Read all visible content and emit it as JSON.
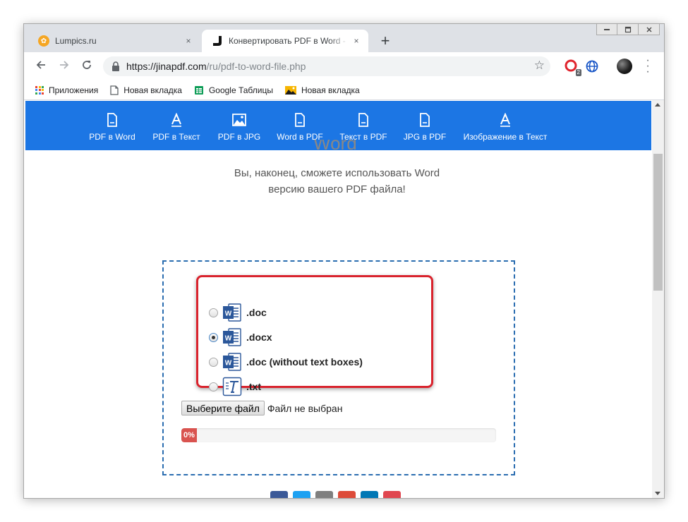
{
  "browser": {
    "tabs": [
      {
        "title": "Lumpics.ru",
        "active": false,
        "favicon": "orange-circle-icon"
      },
      {
        "title": "Конвертировать PDF в Word - PDF",
        "active": true,
        "favicon": "jinapdf-j-icon"
      }
    ],
    "new_tab_label": "+",
    "close_label": "×",
    "url": {
      "host": "https://jinapdf.com",
      "path": "/ru/pdf-to-word-file.php"
    },
    "extension_badge": "2",
    "bookmarks": [
      {
        "label": "Приложения",
        "icon": "apps-grid-icon"
      },
      {
        "label": "Новая вкладка",
        "icon": "page-icon"
      },
      {
        "label": "Google Таблицы",
        "icon": "sheets-icon"
      },
      {
        "label": "Новая вкладка",
        "icon": "image-icon"
      }
    ]
  },
  "colors": {
    "nav_blue": "#1c76e4",
    "dropzone_border": "#2a6db0",
    "highlight_red": "#d9232d",
    "progress_red": "#d9534f",
    "word_blue": "#2b579a"
  },
  "site_nav": [
    {
      "label": "PDF в Word",
      "icon": "file-icon"
    },
    {
      "label": "PDF в Текст",
      "icon": "text-a-icon"
    },
    {
      "label": "PDF в JPG",
      "icon": "image-icon"
    },
    {
      "label": "Word в PDF",
      "icon": "file-icon"
    },
    {
      "label": "Текст в PDF",
      "icon": "file-icon"
    },
    {
      "label": "JPG в PDF",
      "icon": "file-icon"
    },
    {
      "label": "Изображение в Текст",
      "icon": "text-a-icon"
    }
  ],
  "page": {
    "heading_partial": "Word",
    "subtitle_line1": "Вы, наконец, сможете использовать Word",
    "subtitle_line2": "версию вашего PDF файла!"
  },
  "formats": [
    {
      "label": ".doc",
      "checked": false,
      "icon": "word-icon"
    },
    {
      "label": ".docx",
      "checked": true,
      "icon": "word-icon"
    },
    {
      "label": ".doc (without text boxes)",
      "checked": false,
      "icon": "word-icon"
    },
    {
      "label": ".txt",
      "checked": false,
      "icon": "text-file-icon"
    }
  ],
  "file_input": {
    "button_label": "Выберите файл",
    "status": "Файл не выбран"
  },
  "progress": {
    "percent": 0,
    "label": "0%"
  },
  "social_colors": [
    "#3b5998",
    "#1da1f2",
    "#7f7f7f",
    "#dd4b39",
    "#0077b5",
    "#e0464f"
  ]
}
